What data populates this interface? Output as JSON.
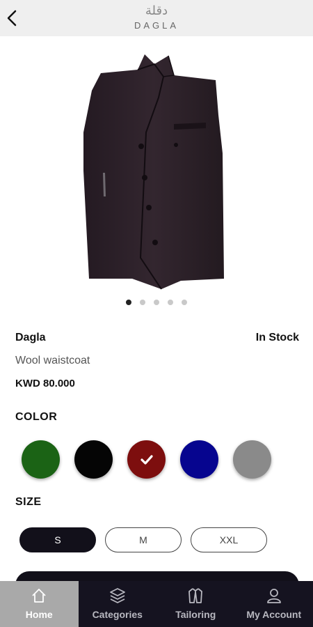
{
  "header": {
    "logo_arabic": "دقلة",
    "logo_text": "DAGLA"
  },
  "product": {
    "image_icon": "waistcoat-photo",
    "brand": "Dagla",
    "stock_status": "In Stock",
    "name": "Wool waistcoat",
    "price": "KWD 80.000",
    "image_count": 5,
    "active_image_index": 0
  },
  "color_section": {
    "label": "COLOR",
    "options": [
      {
        "name": "green",
        "hex": "#1b6315",
        "selected": false
      },
      {
        "name": "black",
        "hex": "#050505",
        "selected": false
      },
      {
        "name": "maroon",
        "hex": "#7d0e0e",
        "selected": true
      },
      {
        "name": "navy",
        "hex": "#06058f",
        "selected": false
      },
      {
        "name": "grey",
        "hex": "#8a8a8a",
        "selected": false
      }
    ]
  },
  "size_section": {
    "label": "SIZE",
    "options": [
      {
        "label": "S",
        "selected": true
      },
      {
        "label": "M",
        "selected": false
      },
      {
        "label": "XXL",
        "selected": false
      }
    ]
  },
  "bottom_nav": {
    "items": [
      {
        "label": "Home",
        "icon": "home-icon",
        "active": true
      },
      {
        "label": "Categories",
        "icon": "layers-icon",
        "active": false
      },
      {
        "label": "Tailoring",
        "icon": "tailoring-icon",
        "active": false
      },
      {
        "label": "My Account",
        "icon": "account-icon",
        "active": false
      }
    ]
  },
  "colors": {
    "header_bg": "#efefef",
    "nav_bg": "#151320",
    "nav_active_bg": "#a9a9a9",
    "primary_dark": "#12101a"
  }
}
